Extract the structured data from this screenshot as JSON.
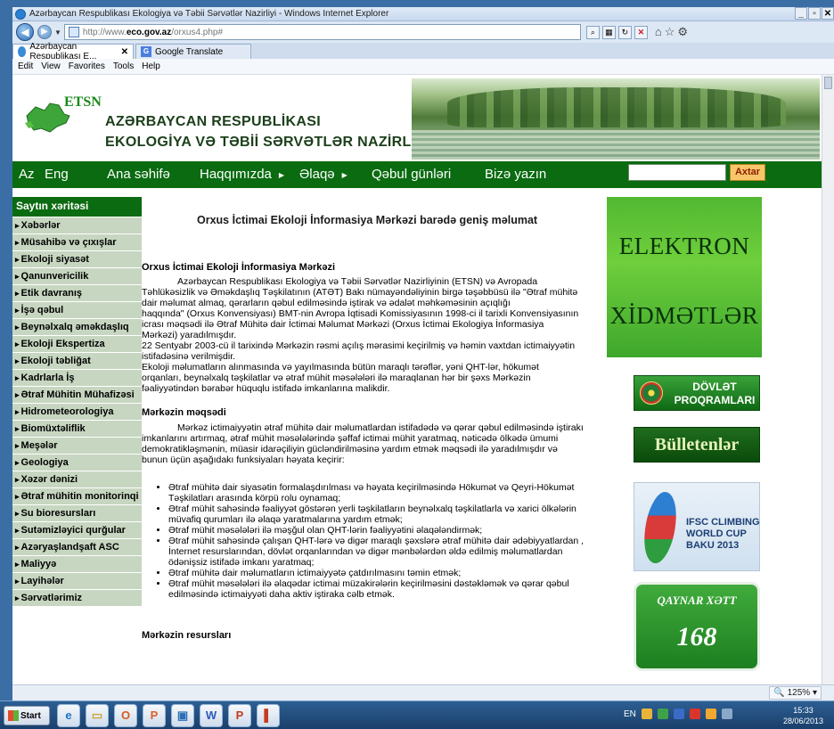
{
  "window": {
    "title": "Azərbaycan Respublikası Ekologiya və Təbii Sərvətlər Nazirliyi - Windows Internet Explorer",
    "url_prefix": "http://www.",
    "url_host": "eco.gov.az",
    "url_path": "/orxus4.php#",
    "tabs": [
      {
        "label": "Azərbaycan Respublikası E..."
      },
      {
        "label": "Google Translate"
      }
    ],
    "menu": [
      "Edit",
      "View",
      "Favorites",
      "Tools",
      "Help"
    ]
  },
  "header": {
    "logo_text": "ETSN",
    "ministry_line1": "AZƏRBAYCAN RESPUBLİKASI",
    "ministry_line2": "EKOLOGİYA VƏ TƏBİİ SƏRVƏTLƏR NAZİRLİYİ"
  },
  "nav": {
    "lang_az": "Az",
    "lang_en": "Eng",
    "items": [
      "Ana səhifə",
      "Haqqımızda",
      "Əlaqə",
      "Qəbul günləri",
      "Bizə yazın"
    ],
    "search_button": "Axtar"
  },
  "sidebar": {
    "title": "Saytın xəritəsi",
    "items": [
      "Xəbərlər",
      "Müsahibə və çıxışlar",
      "Ekoloji siyasət",
      "Qanunvericilik",
      "Etik davranış",
      "İşə qəbul",
      "Beynəlxalq əməkdaşlıq",
      "Ekoloji Ekspertiza",
      "Ekoloji təbliğat",
      "Kadrlarla İş",
      "Ətraf Mühitin Mühafizəsi",
      "Hidrometeorologiya",
      "Biomüxtəliflik",
      "Meşələr",
      "Geologiya",
      "Xəzər dənizi",
      "Ətraf mühitin monitorinqi",
      "Su bioresursları",
      "Sutəmizləyici qurğular",
      "Azəryaşlandşaft ASC",
      "Maliyyə",
      "Layihələr",
      "Sərvətlərimiz"
    ]
  },
  "main": {
    "title": "Orxus İctimai Ekoloji İnformasiya Mərkəzi barədə geniş məlumat",
    "section1_heading": "Orxus İctimai Ekoloji İnformasiya Mərkəzi",
    "section1_lines": [
      "Azərbaycan Respublikası Ekologiya və Təbii Sərvətlər Nazirliyinin (ETSN) və Avropada",
      "Təhlükəsizlik və Əməkdaşlıq Təşkilatının (ATƏT) Bakı nümayəndəliyinin birgə təşəbbüsü ilə \"Ətraf mühitə",
      "dair məlumat almaq, qərarların qəbul edilməsində iştirak və ədalət məhkəməsinin açıqlığı",
      "haqqında\" (Orxus Konvensiyası) BMT-nin Avropa İqtisadi Komissiyasının 1998-ci il tarixli Konvensiyasının",
      "icrası məqsədi ilə Ətraf Mühitə dair İctimai Məlumat Mərkəzi (Orxus İctimai Ekologiya İnformasiya",
      "Mərkəzi) yaradılmışdır.",
      "22 Sentyabr 2003-cü il tarixində Mərkəzin rəsmi açılış mərasimi keçirilmiş və həmin vaxtdan ictimaiyyətin",
      "istifadəsinə verilmişdir.",
      "Ekoloji məlumatların alınmasında və yayılmasında bütün maraqlı tərəflər, yəni QHT-lər, hökumət",
      "orqanları, beynəlxalq təşkilatlar və ətraf mühit məsələləri ilə maraqlanan hər bir şəxs Mərkəzin",
      "fəaliyyətindən bərabər hüquqlu istifadə imkanlarına malikdir."
    ],
    "section2_heading": "Mərkəzin məqsədi",
    "section2_lines": [
      "Mərkəz ictimaiyyətin ətraf mühitə dair məlumatlardan istifadədə və qərar qəbul edilməsində iştirakı",
      "imkanlarını artırmaq, ətraf mühit məsələlərində şəffaf ictimai mühit yaratmaq, nəticədə ölkədə ümumi",
      "demokratikləşmənin, müasir idarəçiliyin gücləndirilməsinə yardım etmək məqsədi ilə yaradılmışdır və",
      "bunun üçün aşağıdakı funksiyaları həyata keçirir:"
    ],
    "bullets": [
      "Ətraf mühitə dair siyasətin formalaşdırılması və həyata keçirilməsində Hökumət və Qeyri-Hökumət Təşkilatları arasında körpü rolu oynamaq;",
      "Ətraf mühit sahəsində fəaliyyət göstərən yerli təşkilatların beynəlxalq təşkilatlarla və xarici ölkələrin müvafiq qurumları ilə əlaqə yaratmalarına yardım etmək;",
      "Ətraf mühit məsələləri ilə məşğul olan QHT-lərin fəaliyyətini əlaqələndirmək;",
      "Ətraf mühit sahəsində çalışan QHT-lərə və digər maraqlı şəxslərə ətraf mühitə dair ədəbiyyatlardan , İnternet resurslarından, dövlət orqanlarından və digər mənbələrdən əldə edilmiş məlumatlardan ödənişsiz istifadə imkanı yaratmaq;",
      "Ətraf mühitə dair məlumatların ictimaiyyətə çatdırılmasını təmin etmək;",
      "Ətraf mühit məsələləri ilə əlaqədar ictimai müzakirələrin keçirilməsini dəstəkləmək və qərar qəbul edilməsində ictimaiyyəti daha aktiv iştiraka cəlb etmək."
    ],
    "section3_heading": "Mərkəzin resursları"
  },
  "right": {
    "banner1_word1": "ELEKTRON",
    "banner1_word2": "XİDMƏTLƏR",
    "banner2_line1": "DÖVLƏT",
    "banner2_line2": "PROQRAMLARI",
    "banner3": "Bülletenlər",
    "banner4_line1": "IFSC CLIMBING",
    "banner4_line2": "WORLD CUP",
    "banner4_line3": "BAKU 2013",
    "banner5_line1": "QAYNAR XƏTT",
    "banner5_line2": "168"
  },
  "status": {
    "zoom": "125%"
  },
  "taskbar": {
    "start_label": "Start",
    "lang": "EN",
    "time": "15:33",
    "date": "28/06/2013"
  }
}
